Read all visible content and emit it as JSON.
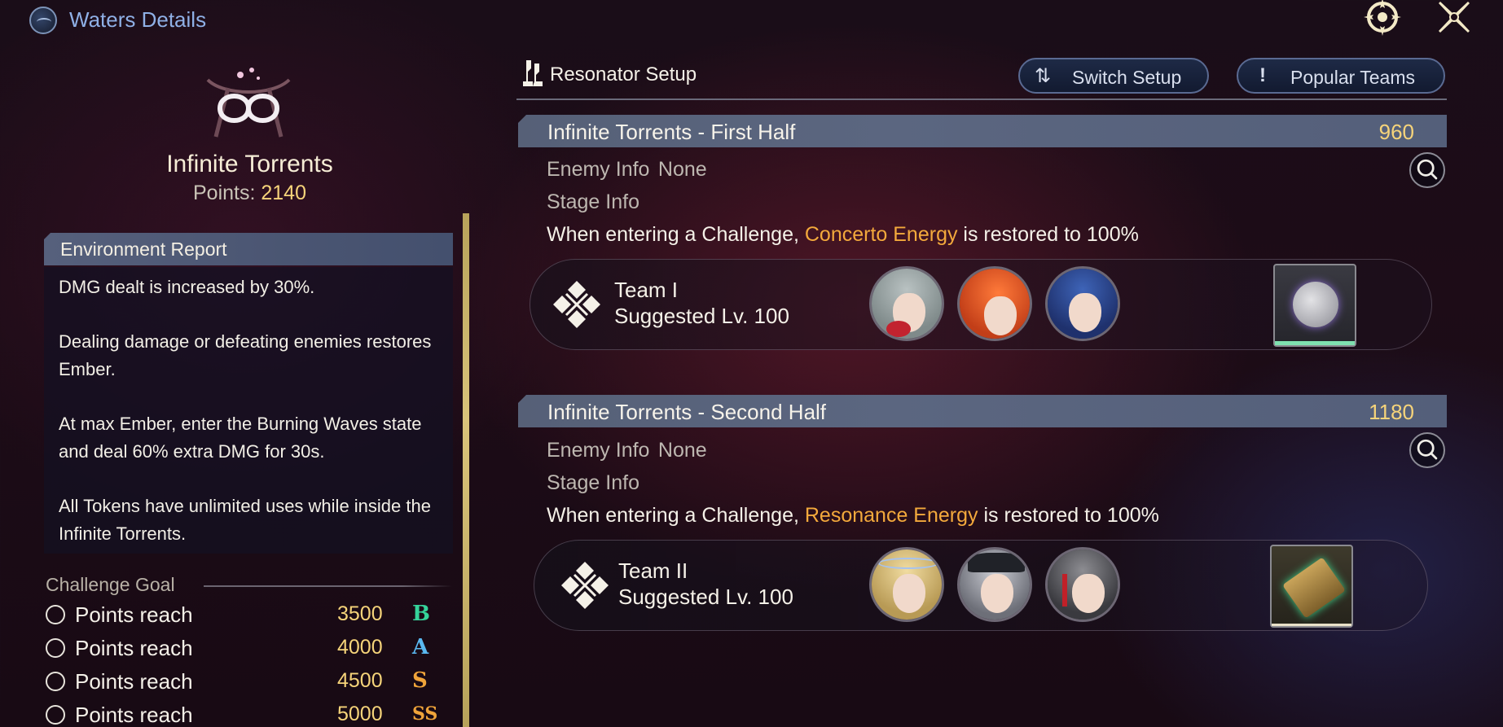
{
  "header": {
    "title": "Waters Details",
    "icons": [
      "tower-emblem-icon",
      "compass-icon",
      "close-icon"
    ]
  },
  "tower": {
    "name": "Infinite Torrents",
    "points_label": "Points:",
    "points_value": "2140"
  },
  "environment": {
    "title": "Environment Report",
    "paragraphs": [
      "DMG dealt is increased by 30%.",
      "Dealing damage or defeating enemies restores Ember.",
      "At max Ember, enter the Burning Waves state and deal 60% extra DMG for 30s.",
      "All Tokens have unlimited uses while inside the Infinite Torrents."
    ]
  },
  "challenge_goal": {
    "title": "Challenge Goal",
    "rows": [
      {
        "label": "Points reach",
        "value": "3500",
        "rank": "B",
        "color": "#35d39a"
      },
      {
        "label": "Points reach",
        "value": "4000",
        "rank": "A",
        "color": "#5ab8f0"
      },
      {
        "label": "Points reach",
        "value": "4500",
        "rank": "S",
        "color": "#f0a43a"
      },
      {
        "label": "Points reach",
        "value": "5000",
        "rank": "SS",
        "color": "#f0a43a"
      }
    ]
  },
  "setup": {
    "title": "Resonator Setup",
    "switch_label": "Switch Setup",
    "popular_label": "Popular Teams"
  },
  "sections": [
    {
      "title": "Infinite Torrents - First Half",
      "points": "960",
      "enemy_label": "Enemy Info",
      "enemy_value": "None",
      "stage_label": "Stage Info",
      "stage_prefix": "When entering a Challenge, ",
      "stage_highlight": "Concerto Energy",
      "stage_suffix": " is restored to 100%",
      "team_name": "Team I",
      "team_level": "Suggested Lv. 100"
    },
    {
      "title": "Infinite Torrents - Second Half",
      "points": "1180",
      "enemy_label": "Enemy Info",
      "enemy_value": "None",
      "stage_label": "Stage Info",
      "stage_prefix": "When entering a Challenge, ",
      "stage_highlight": "Resonance Energy",
      "stage_suffix": " is restored to 100%",
      "team_name": "Team II",
      "team_level": "Suggested Lv. 100"
    }
  ],
  "colors": {
    "accent_gold": "#f6d47a",
    "highlight_orange": "#f3a93c",
    "header_blue": "#8fb0e6"
  }
}
